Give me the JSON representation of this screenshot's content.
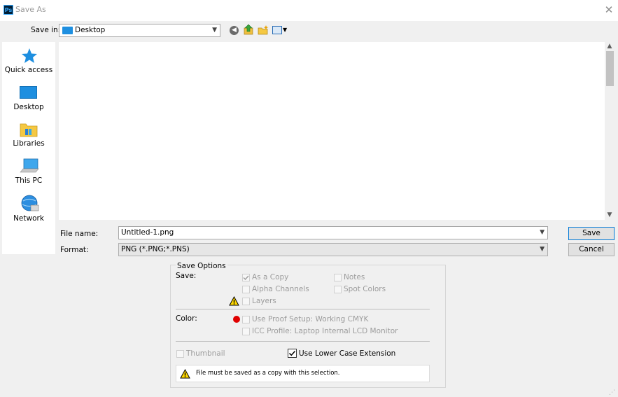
{
  "window": {
    "title": "Save As"
  },
  "toolbar": {
    "save_in_label": "Save in:",
    "save_in_value": "Desktop"
  },
  "places": [
    {
      "label": "Quick access",
      "icon": "star-icon"
    },
    {
      "label": "Desktop",
      "icon": "desktop-icon"
    },
    {
      "label": "Libraries",
      "icon": "libraries-icon"
    },
    {
      "label": "This PC",
      "icon": "computer-icon"
    },
    {
      "label": "Network",
      "icon": "network-icon"
    }
  ],
  "form": {
    "file_name_label": "File name:",
    "file_name_value": "Untitled-1.png",
    "format_label": "Format:",
    "format_value": "PNG (*.PNG;*.PNS)",
    "save_button": "Save",
    "cancel_button": "Cancel"
  },
  "save_options": {
    "title": "Save Options",
    "save_label": "Save:",
    "as_a_copy": "As a Copy",
    "notes": "Notes",
    "alpha_channels": "Alpha Channels",
    "spot_colors": "Spot Colors",
    "layers": "Layers",
    "color_label": "Color:",
    "use_proof_setup": "Use Proof Setup:  Working CMYK",
    "icc_profile": "ICC Profile:  Laptop Internal LCD Monitor",
    "thumbnail": "Thumbnail",
    "use_lower_case_extension": "Use Lower Case Extension",
    "warning_message": "File must be saved as a copy with this selection."
  },
  "colors": {
    "accent": "#0078d7",
    "folder_blue": "#1e8fe0",
    "warning": "#ffd800",
    "error": "#e00000"
  }
}
